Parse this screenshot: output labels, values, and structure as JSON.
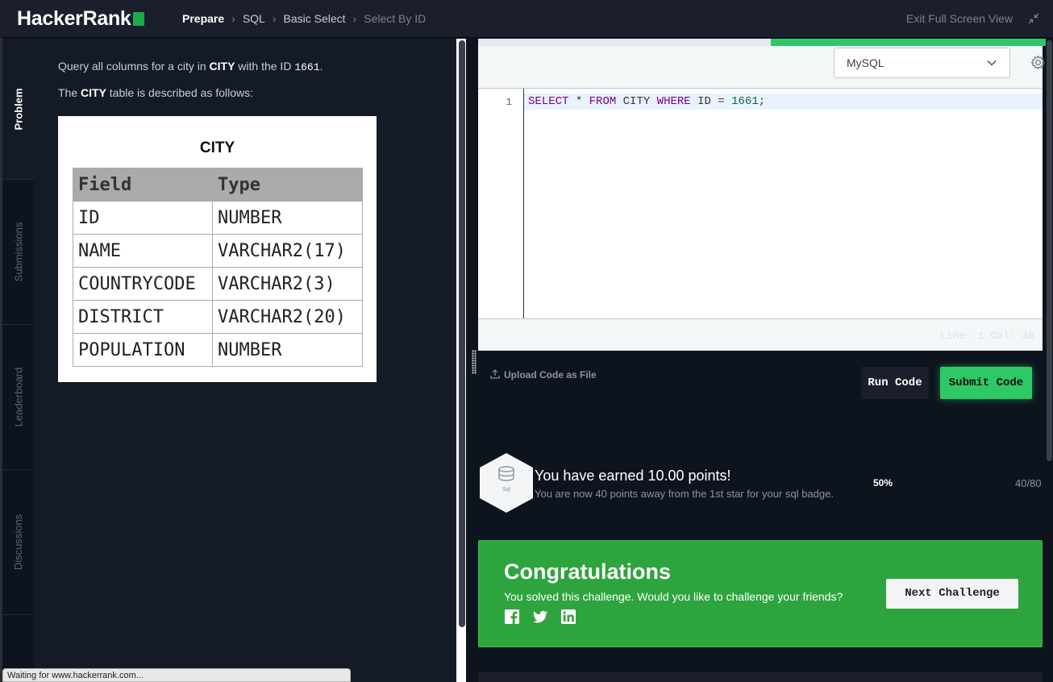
{
  "header": {
    "logo": "HackerRank",
    "breadcrumbs": [
      "Prepare",
      "SQL",
      "Basic Select",
      "Select By ID"
    ],
    "exit_fullscreen": "Exit Full Screen View"
  },
  "rail": {
    "tabs": [
      "Problem",
      "Submissions",
      "Leaderboard",
      "Discussions"
    ]
  },
  "problem": {
    "line1_pre": "Query all columns for a city in ",
    "line1_bold": "CITY",
    "line1_mid": " with the ID ",
    "line1_code": "1661",
    "line1_end": ".",
    "line2_pre": "The ",
    "line2_bold": "CITY",
    "line2_end": " table is described as follows:",
    "table_title": "CITY",
    "table_headers": [
      "Field",
      "Type"
    ],
    "table_rows": [
      [
        "ID",
        "NUMBER"
      ],
      [
        "NAME",
        "VARCHAR2(17)"
      ],
      [
        "COUNTRYCODE",
        "VARCHAR2(3)"
      ],
      [
        "DISTRICT",
        "VARCHAR2(20)"
      ],
      [
        "POPULATION",
        "NUMBER"
      ]
    ]
  },
  "editor": {
    "language": "MySQL",
    "line_number": "1",
    "code": {
      "kw1": "SELECT",
      "t1": " * ",
      "kw2": "FROM",
      "t2": " CITY ",
      "kw3": "WHERE",
      "t3": " ID = ",
      "num": "1661",
      "t4": ";"
    },
    "status": "Line: 1 Col: 36"
  },
  "actions": {
    "upload": "Upload Code as File",
    "run": "Run Code",
    "submit": "Submit Code"
  },
  "points": {
    "badge_label": "Sql",
    "title": "You have earned 10.00 points!",
    "subtitle": "You are now 40 points away from the 1st star for your sql badge.",
    "percent": "50%",
    "ratio": "40/80",
    "progress_fraction": 0.5
  },
  "congrats": {
    "title": "Congratulations",
    "subtitle": "You solved this challenge. Would you like to challenge your friends?",
    "next_button": "Next Challenge",
    "social_icons": [
      "facebook-icon",
      "twitter-icon",
      "linkedin-icon"
    ]
  },
  "browser_status": "Waiting for www.hackerrank.com...",
  "colors": {
    "brand_green": "#1ba94c",
    "submit_green": "#2ec866",
    "congrats_green": "#2ea43f",
    "bg_dark": "#0e141e"
  }
}
